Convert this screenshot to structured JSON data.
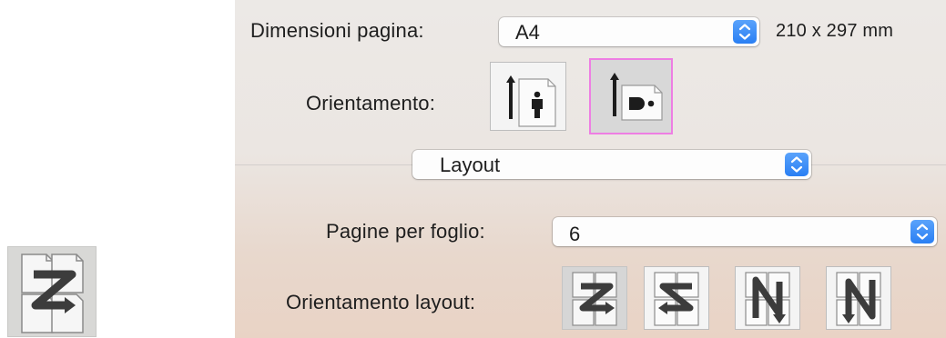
{
  "page_size": {
    "label": "Dimensioni pagina:",
    "value": "A4",
    "dimensions": "210 x 297 mm"
  },
  "orientation": {
    "label": "Orientamento:",
    "options": [
      {
        "icon": "portrait-orientation-icon",
        "selected": false
      },
      {
        "icon": "landscape-orientation-icon",
        "selected": true
      }
    ]
  },
  "section_popup": {
    "value": "Layout"
  },
  "pages_per_sheet": {
    "label": "Pagine per foglio:",
    "value": "6"
  },
  "layout_direction": {
    "label": "Orientamento layout:",
    "options": [
      {
        "icon": "z-order-icon",
        "selected": true
      },
      {
        "icon": "reverse-z-order-icon",
        "selected": false
      },
      {
        "icon": "reverse-n-order-icon",
        "selected": false
      },
      {
        "icon": "n-order-icon",
        "selected": false
      }
    ]
  },
  "colors": {
    "accent": "#2a7ff3",
    "selection_outline": "#ee7ee3"
  }
}
